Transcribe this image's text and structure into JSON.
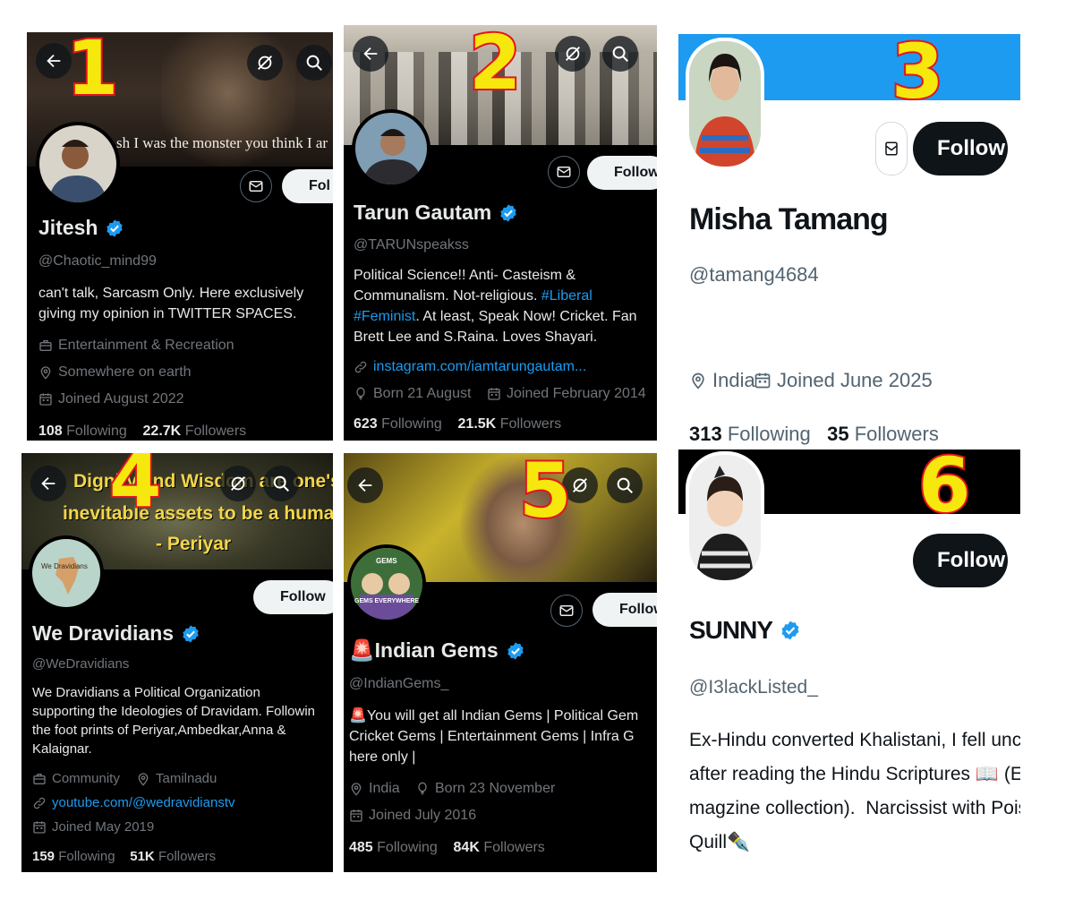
{
  "colors": {
    "accent": "#1d9bf0",
    "number_fill": "#f6e80d",
    "number_stroke": "#e4141d",
    "dark_bg": "#000000",
    "banner3": "#1d9bf0"
  },
  "panels": [
    {
      "number": "1",
      "banner_text": "sh I was the monster you think I ar",
      "follow_label": "Fol",
      "name": "Jitesh",
      "handle": "@Chaotic_mind99",
      "bio": "can't talk, Sarcasm Only. Here exclusively\ngiving my opinion in TWITTER SPACES.",
      "category": "Entertainment & Recreation",
      "location": "Somewhere on earth",
      "joined": "Joined August 2022",
      "following_count": "108",
      "following_label": "Following",
      "followers_count": "22.7K",
      "followers_label": "Followers"
    },
    {
      "number": "2",
      "follow_label": "Follow",
      "name": "Tarun Gautam",
      "handle": "@TARUNspeakss",
      "bio_line1": "Political Science!! Anti- Casteism &",
      "bio_line2a": "Communalism. Not-religious. ",
      "bio_tag1": "#Liberal",
      "bio_tag2": "#Feminist",
      "bio_line3": ". At least, Speak Now! Cricket. Fan",
      "bio_line4": "Brett Lee and S.Raina.  Loves Shayari.",
      "link": "instagram.com/iamtarungautam...",
      "born": "Born 21 August",
      "joined": "Joined February 2014",
      "following_count": "623",
      "following_label": "Following",
      "followers_count": "21.5K",
      "followers_label": "Followers"
    },
    {
      "number": "3",
      "follow_label": "Follow",
      "name": "Misha Tamang",
      "handle": "@tamang4684",
      "location": "India",
      "joined": "Joined June 2025",
      "following_count": "313",
      "following_label": "Following",
      "followers_count": "35",
      "followers_label": "Followers"
    },
    {
      "number": "4",
      "banner_line1": "Dignity and Wisdom are one's",
      "banner_line2": "inevitable assets to be a human",
      "banner_line3": "- Periyar",
      "avatar_text": "We Dravidians",
      "follow_label": "Follow",
      "name": "We Dravidians",
      "handle": "@WeDravidians",
      "bio": "We Dravidians a Political Organization\nsupporting the Ideologies of Dravidam. Followin\nthe foot prints of Periyar,Ambedkar,Anna &\nKalaignar.",
      "category": "Community",
      "location": "Tamilnadu",
      "link": "youtube.com/@wedravidianstv",
      "joined": "Joined May 2019",
      "following_count": "159",
      "following_label": "Following",
      "followers_count": "51K",
      "followers_label": "Followers"
    },
    {
      "number": "5",
      "avatar_text_top": "GEMS",
      "avatar_text_bottom": "GEMS EVERYWHERE",
      "follow_label": "Follow",
      "name": "🚨Indian Gems",
      "handle": "@IndianGems_",
      "bio": "🚨You will get all Indian Gems | Political Gem\nCricket Gems | Entertainment Gems | Infra G\nhere only |",
      "location": "India",
      "born": "Born 23 November",
      "joined": "Joined July 2016",
      "following_count": "485",
      "following_label": "Following",
      "followers_count": "84K",
      "followers_label": "Followers"
    },
    {
      "number": "6",
      "follow_label": "Follow",
      "name": "SUNNY",
      "handle": "@I3lackListed_",
      "bio": "Ex-Hindu converted Khalistani, I fell unconscious\nafter reading the Hindu Scriptures 📖 (Erotic\nmagzine collection).  Narcissist with Poisoned\nQuill✒️"
    }
  ]
}
